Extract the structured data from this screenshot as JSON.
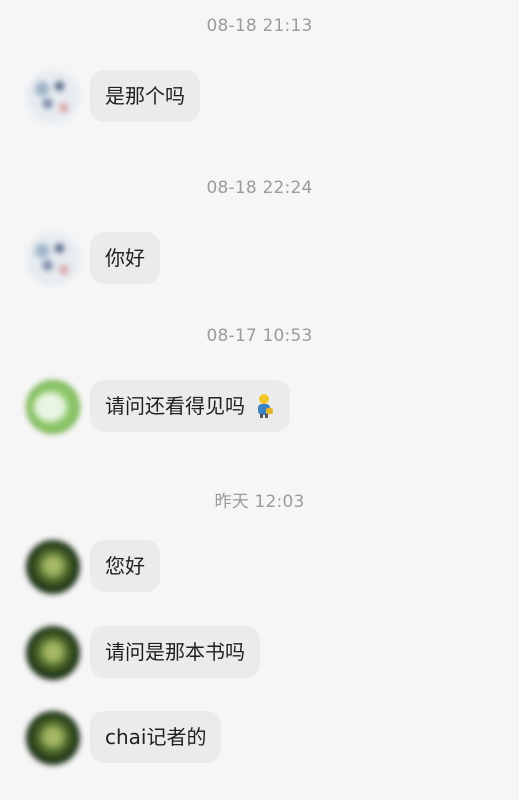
{
  "messages": [
    {
      "timestamp": "08-18 21:13",
      "text": "是那个吗",
      "avatar_style": "snow-scene"
    },
    {
      "timestamp": "08-18 22:24",
      "text": "你好",
      "avatar_style": "snow-scene"
    },
    {
      "timestamp": "08-17 10:53",
      "text": "请问还看得见吗",
      "emoji": "person-icon",
      "avatar_style": "green-cloud"
    },
    {
      "timestamp": "昨天 12:03",
      "text": "您好",
      "avatar_style": "dark-green"
    },
    {
      "text": "请问是那本书吗",
      "avatar_style": "dark-green"
    },
    {
      "text": "chai记者的",
      "avatar_style": "dark-green"
    }
  ],
  "colors": {
    "background": "#f6f6f6",
    "bubble": "#ebebeb",
    "timestamp_text": "#9b9b9b",
    "message_text": "#1f1f1f"
  }
}
